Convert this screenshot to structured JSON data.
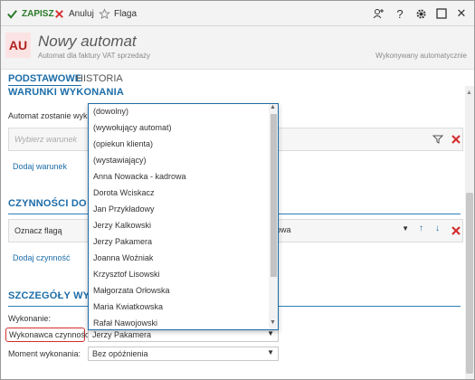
{
  "toolbar": {
    "save_label": "ZAPISZ",
    "cancel_label": "Anuluj",
    "flag_label": "Flaga",
    "right_icons": [
      "add-person-icon",
      "help-icon",
      "gear-icon",
      "maximize-icon",
      "close-icon"
    ],
    "help_glyph": "?",
    "close_glyph": "✕"
  },
  "header": {
    "avatar_text": "AU",
    "title": "Nowy automat",
    "subtitle": "Automat dla faktury VAT sprzedaży",
    "right_meta": "Wykonywany automatycznie"
  },
  "tabs": [
    {
      "label": "PODSTAWOWE",
      "active": true
    },
    {
      "label": "HISTORIA",
      "active": false
    }
  ],
  "sections": {
    "conditions": {
      "title": "WARUNKI WYKONANIA",
      "intro": "Automat zostanie wykon",
      "placeholder": "Wybierz warunek",
      "add_link": "Dodaj warunek"
    },
    "actions": {
      "title": "CZYNNOŚCI DO WY",
      "action_value": "Oznacz flagą",
      "action_suffix": "owa",
      "add_link": "Dodaj czynność"
    },
    "details": {
      "title": "SZCZEGÓŁY WYKON",
      "performed_label": "Wykonanie:",
      "performer_label": "Wykonawca czynności:",
      "performer_value": "Jerzy Pakamera",
      "moment_label": "Moment wykonania:",
      "moment_value": "Bez opóźnienia"
    }
  },
  "dropdown": {
    "items": [
      "(dowolny)",
      "(wywołujący automat)",
      "(opiekun klienta)",
      "(wystawiający)",
      "Anna Nowacka - kadrowa",
      "Dorota Wciskacz",
      "Jan Przykładowy",
      "Jerzy Kalkowski",
      "Jerzy Pakamera",
      "Joanna Woźniak",
      "Krzysztof Lisowski",
      "Małgorzata Orłowska",
      "Maria Kwiatkowska",
      "Rafał Nawojowski"
    ]
  },
  "colors": {
    "accent": "#1b6ca8",
    "save_green": "#2a7a2a",
    "danger": "#d32f2f",
    "avatar_bg": "#fbe3e3"
  }
}
